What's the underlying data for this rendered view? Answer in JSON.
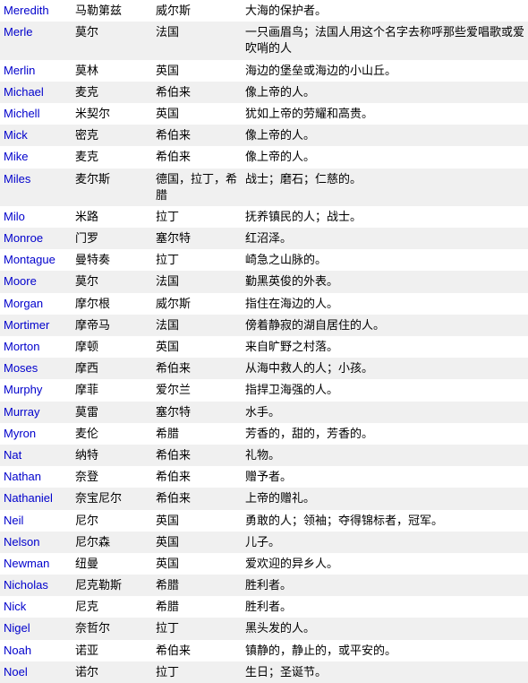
{
  "rows": [
    {
      "name": "Meredith",
      "chinese": "马勒第兹",
      "origin": "威尔斯",
      "meaning": "大海的保护者。"
    },
    {
      "name": "Merle",
      "chinese": "莫尔",
      "origin": "法国",
      "meaning": "一只画眉鸟；法国人用这个名字去称呼那些爱唱歌或爱吹哨的人"
    },
    {
      "name": "Merlin",
      "chinese": "莫林",
      "origin": "英国",
      "meaning": "海边的堡垒或海边的小山丘。"
    },
    {
      "name": "Michael",
      "chinese": "麦克",
      "origin": "希伯来",
      "meaning": "像上帝的人。"
    },
    {
      "name": "Michell",
      "chinese": "米契尔",
      "origin": "英国",
      "meaning": "犹如上帝的劳耀和高贵。"
    },
    {
      "name": "Mick",
      "chinese": "密克",
      "origin": "希伯来",
      "meaning": "像上帝的人。"
    },
    {
      "name": "Mike",
      "chinese": "麦克",
      "origin": "希伯来",
      "meaning": "像上帝的人。"
    },
    {
      "name": "Miles",
      "chinese": "麦尔斯",
      "origin": "德国，拉丁，希腊",
      "meaning": "战士；磨石；仁慈的。"
    },
    {
      "name": "Milo",
      "chinese": "米路",
      "origin": "拉丁",
      "meaning": "抚养镇民的人；战士。"
    },
    {
      "name": "Monroe",
      "chinese": "门罗",
      "origin": "塞尔特",
      "meaning": "红沼泽。"
    },
    {
      "name": "Montague",
      "chinese": "曼特奏",
      "origin": "拉丁",
      "meaning": "崎急之山脉的。"
    },
    {
      "name": "Moore",
      "chinese": "莫尔",
      "origin": "法国",
      "meaning": "勤黑英俊的外表。"
    },
    {
      "name": "Morgan",
      "chinese": "摩尔根",
      "origin": "威尔斯",
      "meaning": "指住在海边的人。"
    },
    {
      "name": "Mortimer",
      "chinese": "摩帝马",
      "origin": "法国",
      "meaning": "傍着静寂的湖自居住的人。"
    },
    {
      "name": "Morton",
      "chinese": "摩顿",
      "origin": "英国",
      "meaning": "来自旷野之村落。"
    },
    {
      "name": "Moses",
      "chinese": "摩西",
      "origin": "希伯来",
      "meaning": "从海中救人的人；小孩。"
    },
    {
      "name": "Murphy",
      "chinese": "摩菲",
      "origin": "爱尔兰",
      "meaning": "指捍卫海强的人。"
    },
    {
      "name": "Murray",
      "chinese": "莫雷",
      "origin": "塞尔特",
      "meaning": "水手。"
    },
    {
      "name": "Myron",
      "chinese": "麦伦",
      "origin": "希腊",
      "meaning": "芳香的，甜的，芳香的。"
    },
    {
      "name": "Nat",
      "chinese": "纳特",
      "origin": "希伯来",
      "meaning": "礼物。"
    },
    {
      "name": "Nathan",
      "chinese": "奈登",
      "origin": "希伯来",
      "meaning": "赠予者。"
    },
    {
      "name": "Nathaniel",
      "chinese": "奈宝尼尔",
      "origin": "希伯来",
      "meaning": "上帝的赠礼。"
    },
    {
      "name": "Neil",
      "chinese": "尼尔",
      "origin": "英国",
      "meaning": "勇敢的人；领袖；夺得锦标者，冠军。"
    },
    {
      "name": "Nelson",
      "chinese": "尼尔森",
      "origin": "英国",
      "meaning": "儿子。"
    },
    {
      "name": "Newman",
      "chinese": "纽曼",
      "origin": "英国",
      "meaning": "爱欢迎的异乡人。"
    },
    {
      "name": "Nicholas",
      "chinese": "尼克勒斯",
      "origin": "希腊",
      "meaning": "胜利者。"
    },
    {
      "name": "Nick",
      "chinese": "尼克",
      "origin": "希腊",
      "meaning": "胜利者。"
    },
    {
      "name": "Nigel",
      "chinese": "奈哲尔",
      "origin": "拉丁",
      "meaning": "黑头发的人。"
    },
    {
      "name": "Noah",
      "chinese": "诺亚",
      "origin": "希伯来",
      "meaning": "镇静的，静止的，或平安的。"
    },
    {
      "name": "Noel",
      "chinese": "诺尔",
      "origin": "拉丁",
      "meaning": "生日；圣诞节。"
    }
  ]
}
